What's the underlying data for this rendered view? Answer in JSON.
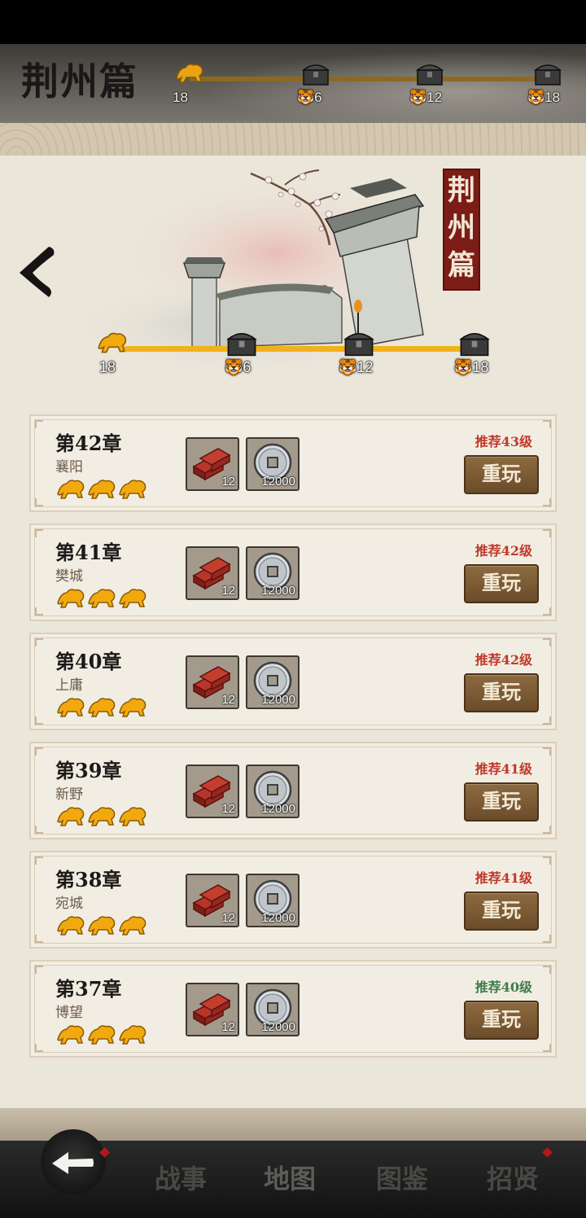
{
  "header": {
    "title": "荆州篇",
    "progress": {
      "fraction": 0.0,
      "nodes": [
        {
          "label": "18",
          "icon": "tiger-icon"
        },
        {
          "label": "6",
          "icon": "chest-icon"
        },
        {
          "label": "12",
          "icon": "chest-icon"
        },
        {
          "label": "18",
          "icon": "chest-icon"
        }
      ]
    }
  },
  "banner": {
    "seal_text": [
      "荆",
      "州",
      "篇"
    ],
    "progress": {
      "fraction": 1.0,
      "nodes": [
        {
          "label": "18",
          "icon": "tiger-icon"
        },
        {
          "label": "6",
          "icon": "chest-icon"
        },
        {
          "label": "12",
          "icon": "chest-icon"
        },
        {
          "label": "18",
          "icon": "chest-icon"
        }
      ]
    }
  },
  "chapters": [
    {
      "title": "第42章",
      "place": "襄阳",
      "stars": 3,
      "rewards": [
        "12",
        "12000"
      ],
      "recommend": "推荐43级",
      "recommend_color": "#c0392b",
      "button": "重玩"
    },
    {
      "title": "第41章",
      "place": "樊城",
      "stars": 3,
      "rewards": [
        "12",
        "12000"
      ],
      "recommend": "推荐42级",
      "recommend_color": "#c0392b",
      "button": "重玩"
    },
    {
      "title": "第40章",
      "place": "上庸",
      "stars": 3,
      "rewards": [
        "12",
        "12000"
      ],
      "recommend": "推荐42级",
      "recommend_color": "#c0392b",
      "button": "重玩"
    },
    {
      "title": "第39章",
      "place": "新野",
      "stars": 3,
      "rewards": [
        "12",
        "12000"
      ],
      "recommend": "推荐41级",
      "recommend_color": "#c0392b",
      "button": "重玩"
    },
    {
      "title": "第38章",
      "place": "宛城",
      "stars": 3,
      "rewards": [
        "12",
        "12000"
      ],
      "recommend": "推荐41级",
      "recommend_color": "#c0392b",
      "button": "重玩"
    },
    {
      "title": "第37章",
      "place": "博望",
      "stars": 3,
      "rewards": [
        "12",
        "12000"
      ],
      "recommend": "推荐40级",
      "recommend_color": "#3f7d4a",
      "button": "重玩"
    }
  ],
  "nav": {
    "items": [
      {
        "label": "战事",
        "badge": false
      },
      {
        "label": "地图",
        "badge": false,
        "active": true
      },
      {
        "label": "图鉴",
        "badge": false
      },
      {
        "label": "招贤",
        "badge": true
      }
    ]
  },
  "colors": {
    "accent_gold": "#f0b21c",
    "seal_red": "#7c1c16",
    "button_brown": "#7a5a34",
    "badge_red": "#b0181a"
  }
}
